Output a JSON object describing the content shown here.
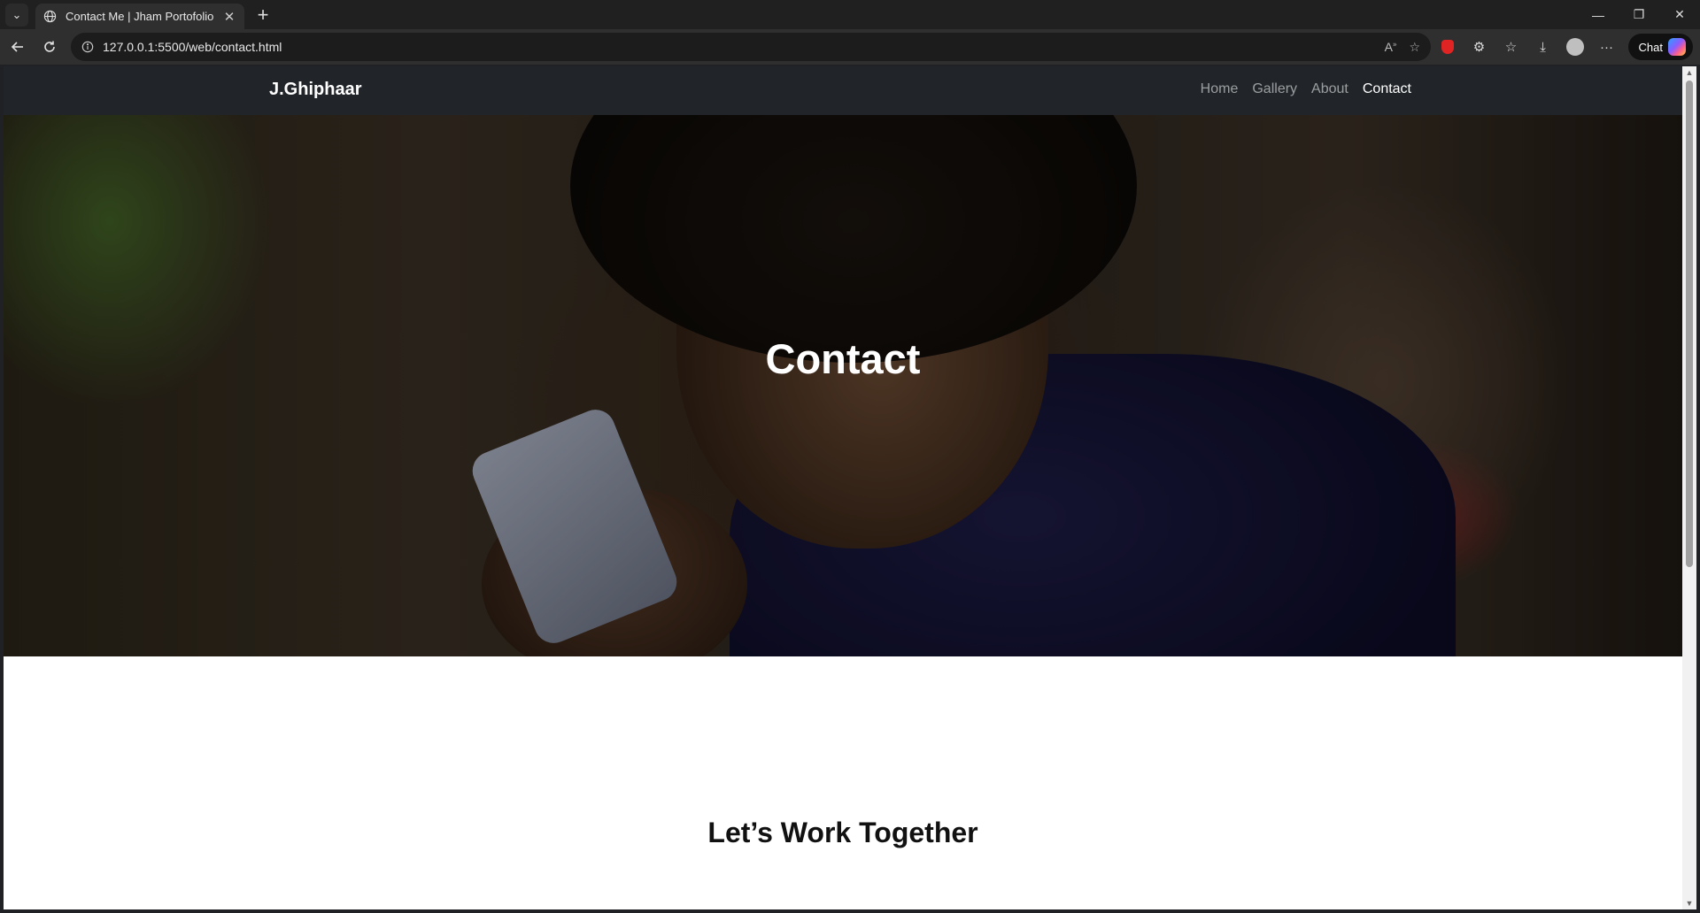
{
  "browser": {
    "tab_title": "Contact Me | Jham Portofolio",
    "url": "127.0.0.1:5500/web/contact.html",
    "chat_label": "Chat"
  },
  "site": {
    "brand": "J.Ghiphaar",
    "nav": [
      {
        "label": "Home",
        "active": false
      },
      {
        "label": "Gallery",
        "active": false
      },
      {
        "label": "About",
        "active": false
      },
      {
        "label": "Contact",
        "active": true
      }
    ],
    "hero_title": "Contact",
    "section_title": "Let’s Work Together"
  }
}
